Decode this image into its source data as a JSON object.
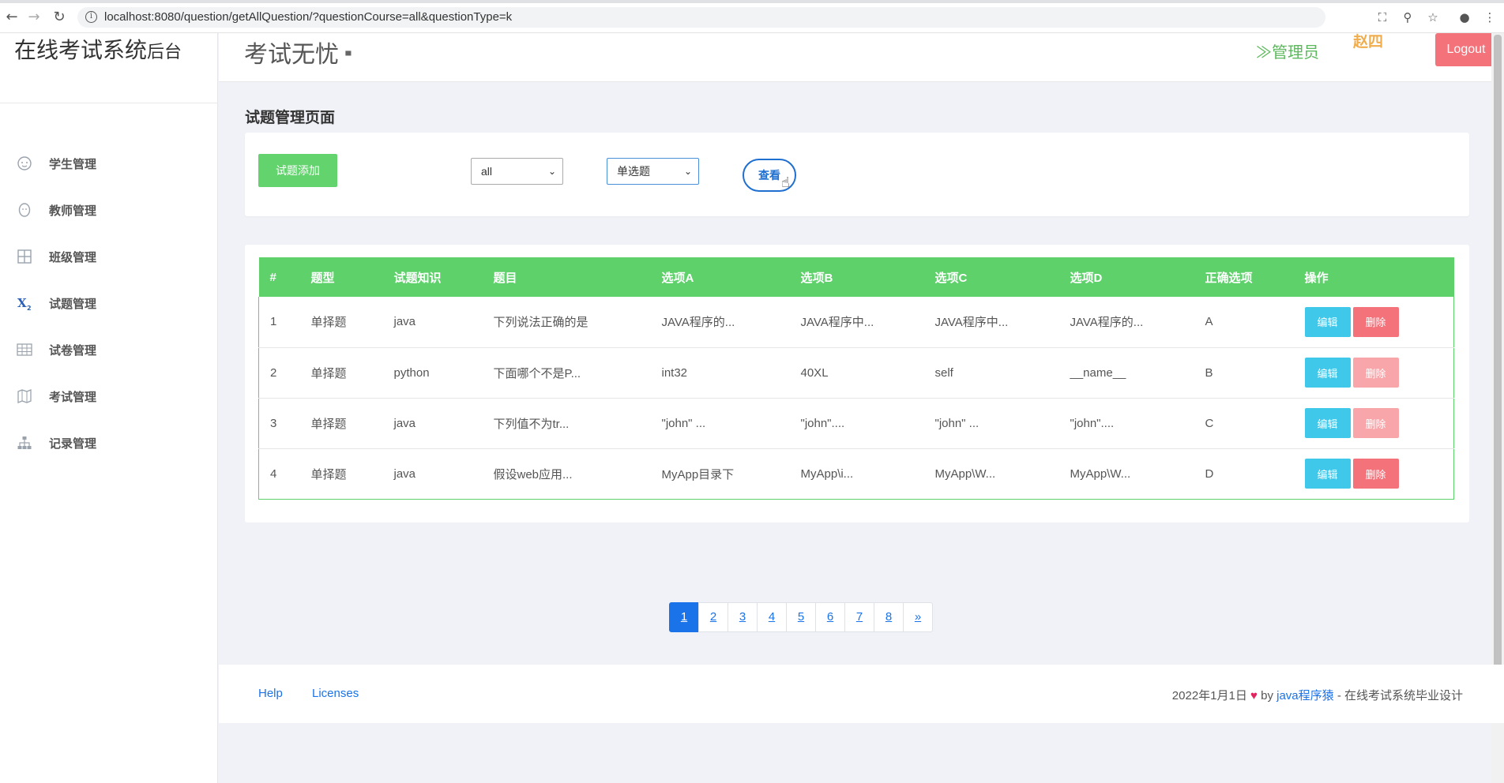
{
  "browser": {
    "url": "localhost:8080/question/getAllQuestion/?questionCourse=all&questionType=k"
  },
  "sidebar": {
    "brand_main": "在线考试系统",
    "brand_sub": "后台",
    "items": [
      {
        "label": "学生管理",
        "icon": "baby-face-icon"
      },
      {
        "label": "教师管理",
        "icon": "face-icon"
      },
      {
        "label": "班级管理",
        "icon": "grid-icon"
      },
      {
        "label": "试题管理",
        "icon": "subscript-x-icon"
      },
      {
        "label": "试卷管理",
        "icon": "table-icon"
      },
      {
        "label": "考试管理",
        "icon": "map-icon"
      },
      {
        "label": "记录管理",
        "icon": "hierarchy-icon"
      }
    ]
  },
  "header": {
    "title": "考试无忧",
    "admin_label": "管理员",
    "user_name": "赵四",
    "logout_label": "Logout"
  },
  "page": {
    "heading": "试题管理页面"
  },
  "filters": {
    "add_label": "试题添加",
    "course_value": "all",
    "type_value": "单选题",
    "view_label": "查看"
  },
  "table": {
    "headers": [
      "#",
      "题型",
      "试题知识",
      "题目",
      "选项A",
      "选项B",
      "选项C",
      "选项D",
      "正确选项",
      "操作"
    ],
    "rows": [
      {
        "id": "1",
        "type": "单择题",
        "topic": "java",
        "question": "下列说法正确的是",
        "a": "JAVA程序的...",
        "b": "JAVA程序中...",
        "c": "JAVA程序中...",
        "d": "JAVA程序的...",
        "answer": "A"
      },
      {
        "id": "2",
        "type": "单择题",
        "topic": "python",
        "question": "下面哪个不是P...",
        "a": "int32",
        "b": "40XL",
        "c": "self",
        "d": "__name__",
        "answer": "B"
      },
      {
        "id": "3",
        "type": "单择题",
        "topic": "java",
        "question": "下列值不为tr...",
        "a": "\"john\" ...",
        "b": "\"john\"....",
        "c": "\"john\" ...",
        "d": "\"john\"....",
        "answer": "C"
      },
      {
        "id": "4",
        "type": "单择题",
        "topic": "java",
        "question": "假设web应用...",
        "a": "MyApp目录下",
        "b": "MyApp\\i...",
        "c": "MyApp\\W...",
        "d": "MyApp\\W...",
        "answer": "D"
      }
    ],
    "edit_label": "编辑",
    "delete_label": "删除"
  },
  "pagination": {
    "pages": [
      "1",
      "2",
      "3",
      "4",
      "5",
      "6",
      "7",
      "8",
      "»"
    ],
    "active": "1"
  },
  "footer": {
    "help": "Help",
    "licenses": "Licenses",
    "date": "2022年1月1日",
    "by": "by",
    "author": "java程序猿",
    "suffix": "- 在线考试系统毕业设计"
  },
  "colors": {
    "primary_green": "#5ed16b",
    "edit_blue": "#3fc8ea",
    "delete_red": "#f4727a",
    "logout_red": "#f4727a",
    "admin_green": "#5cb85c",
    "user_orange": "#f0ad4e",
    "link_blue": "#1a73e8"
  }
}
